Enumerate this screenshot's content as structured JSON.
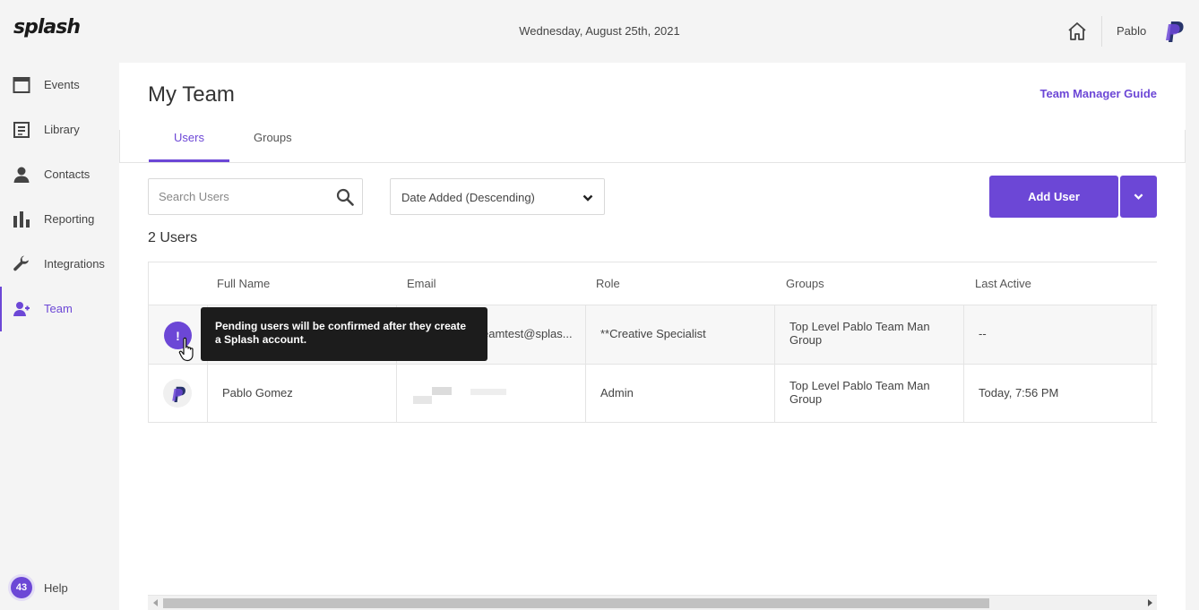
{
  "app": {
    "logo": "splash",
    "date": "Wednesday, August 25th, 2021",
    "user_name": "Pablo"
  },
  "sidebar": {
    "items": [
      {
        "label": "Events",
        "icon": "calendar-icon"
      },
      {
        "label": "Library",
        "icon": "library-icon"
      },
      {
        "label": "Contacts",
        "icon": "person-icon"
      },
      {
        "label": "Reporting",
        "icon": "bar-chart-icon"
      },
      {
        "label": "Integrations",
        "icon": "wrench-icon"
      },
      {
        "label": "Team",
        "icon": "team-icon",
        "active": true
      }
    ],
    "help": {
      "badge": "43",
      "label": "Help"
    }
  },
  "main": {
    "title": "My Team",
    "guide_link": "Team Manager Guide",
    "tabs": [
      {
        "label": "Users",
        "active": true
      },
      {
        "label": "Groups",
        "active": false
      }
    ],
    "search": {
      "placeholder": "Search Users",
      "value": ""
    },
    "sort": {
      "selected": "Date Added (Descending)"
    },
    "add_user_label": "Add User",
    "count_label": "2 Users",
    "table": {
      "headers": [
        "Full Name",
        "Email",
        "Role",
        "Groups",
        "Last Active"
      ],
      "rows": [
        {
          "status": "pending",
          "badge": "!",
          "full_name": "",
          "email": "eamtest@splas...",
          "role": "**Creative Specialist",
          "groups": "Top Level Pablo Team Man Group",
          "last_active": "--"
        },
        {
          "status": "active",
          "full_name": "Pablo Gomez",
          "email": "",
          "role": "Admin",
          "groups": "Top Level Pablo Team Man Group",
          "last_active": "Today, 7:56 PM"
        }
      ]
    },
    "tooltip": "Pending users will be confirmed after they create a Splash account."
  },
  "colors": {
    "accent": "#6c47d6",
    "background": "#f4f4f4",
    "tooltip_bg": "#1c1c1c"
  }
}
